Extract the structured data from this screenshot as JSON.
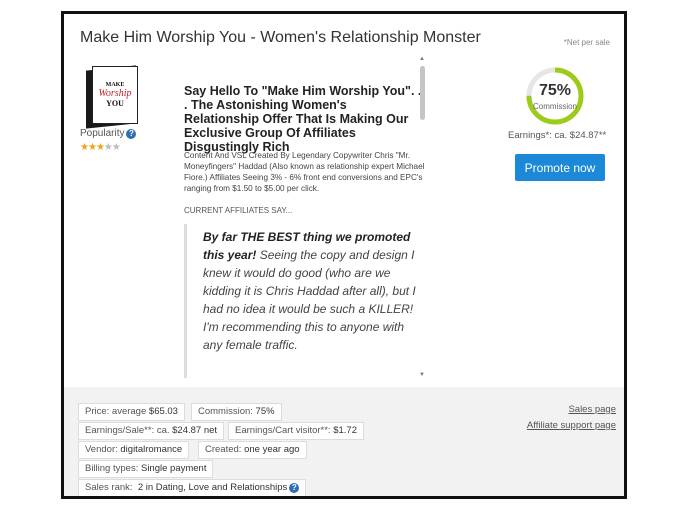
{
  "product": {
    "title": "Make Him Worship You - Women's Relationship Monster",
    "net_per_sale": "*Net per sale",
    "box_lines": [
      "MAKE",
      "Worship",
      "YOU"
    ],
    "popularity_label": "Popularity",
    "popularity_help": "?",
    "rating": 3,
    "rating_max": 5
  },
  "description": {
    "headline": "Say Hello To \"Make Him Worship You\". . . The Astonishing Women's Relationship Offer That Is Making Our Exclusive Group Of Affiliates Disgustingly Rich",
    "body": "Content And VSL Created By Legendary Copywriter Chris \"Mr. Moneyfingers\" Haddad (Also known as relationship expert Michael Fiore.) Affiliates Seeing 3% - 6% front end conversions and EPC's ranging from $1.50 to $5.00 per click.",
    "current_affiliates": "CURRENT AFFILIATES SAY...",
    "quote_bold": "By far THE BEST thing we promoted this year!",
    "quote_rest": " Seeing the copy and design I knew it would do good (who are we kidding it is Chris Haddad after all), but I had no idea it would be such a KILLER! I'm recommending this to anyone with any female traffic."
  },
  "commission": {
    "percent": "75%",
    "label": "Commission",
    "value": 0.75,
    "earnings_text": "Earnings*: ca. $24.87**",
    "promote_label": "Promote now",
    "ring_color": "#9ccc1a"
  },
  "stats": {
    "price_label": "Price: average",
    "price_value": "$65.03",
    "commission_label": "Commission:",
    "commission_value": "75%",
    "earnings_sale_label": "Earnings/Sale**: ca.",
    "earnings_sale_value": "$24.87 net",
    "earnings_cart_label": "Earnings/Cart visitor**:",
    "earnings_cart_value": "$1.72",
    "vendor_label": "Vendor:",
    "vendor_value": "digitalromance",
    "created_label": "Created:",
    "created_value": "one year ago",
    "billing_label": "Billing types:",
    "billing_value": "Single payment",
    "rank_label": "Sales rank:",
    "rank_value": "2 in Dating, Love and Relationships",
    "rank_help": "?"
  },
  "links": {
    "sales_page": "Sales page",
    "affiliate_support": "Affiliate support page"
  }
}
